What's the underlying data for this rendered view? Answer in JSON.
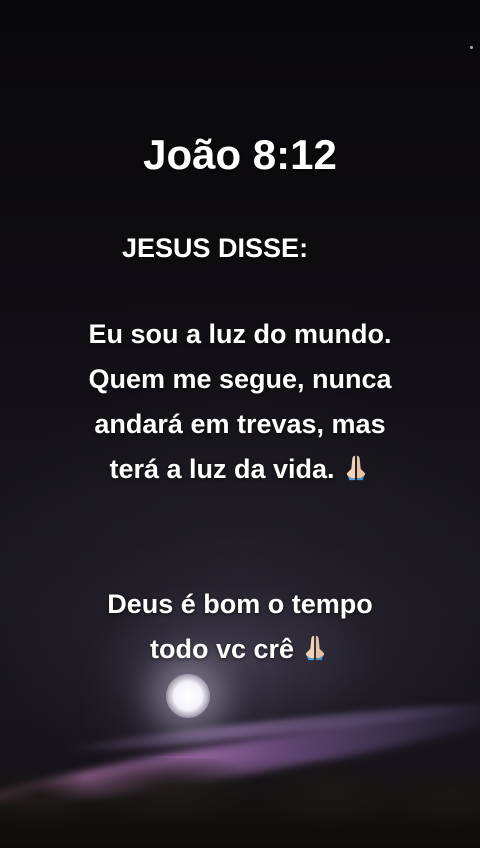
{
  "story": {
    "title": "João 8:12",
    "subtitle": "JESUS DISSE:",
    "verse": "Eu sou a luz do mundo. Quem me segue, nunca andará em trevas, mas terá a luz da vida.",
    "closing": "Deus é bom o tempo todo vc crê",
    "emoji_icon": "folded-hands-icon"
  },
  "colors": {
    "text": "#ffffff",
    "sky_top": "#08070a",
    "streak": "#ffaae6"
  }
}
